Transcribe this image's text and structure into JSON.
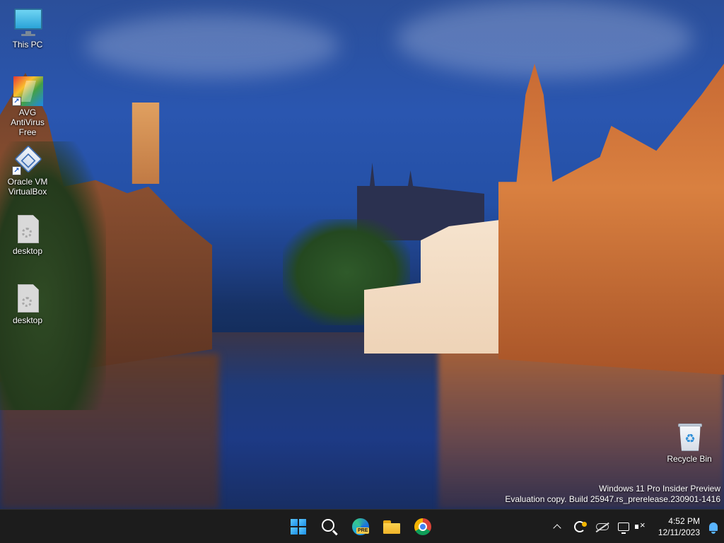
{
  "desktop": {
    "icons": [
      {
        "label": "This PC",
        "icon": "monitor-icon"
      },
      {
        "label": "AVG AntiVirus Free",
        "icon": "avg-antivirus-icon",
        "shortcut": true
      },
      {
        "label": "Oracle VM VirtualBox",
        "icon": "virtualbox-icon",
        "shortcut": true
      },
      {
        "label": "desktop",
        "icon": "file-settings-icon"
      },
      {
        "label": "desktop",
        "icon": "file-settings-icon"
      },
      {
        "label": "Recycle Bin",
        "icon": "recycle-bin-icon"
      }
    ]
  },
  "watermark": {
    "line1": "Windows 11 Pro Insider Preview",
    "line2": "Evaluation copy. Build 25947.rs_prerelease.230901-1416"
  },
  "taskbar": {
    "pinned": [
      {
        "name": "start",
        "icon": "windows-start-icon"
      },
      {
        "name": "search",
        "icon": "search-icon"
      },
      {
        "name": "edge-preview",
        "icon": "edge-preview-icon",
        "badge": "PRE"
      },
      {
        "name": "file-explorer",
        "icon": "folder-icon"
      },
      {
        "name": "chrome",
        "icon": "chrome-icon"
      }
    ],
    "tray": {
      "icons": [
        "chevron-up-icon",
        "sync-icon",
        "cloud-off-icon",
        "network-icon",
        "volume-muted-icon",
        "notification-bell-icon"
      ],
      "time": "4:52 PM",
      "date": "12/11/2023"
    },
    "accent": "#1b8ee6"
  }
}
